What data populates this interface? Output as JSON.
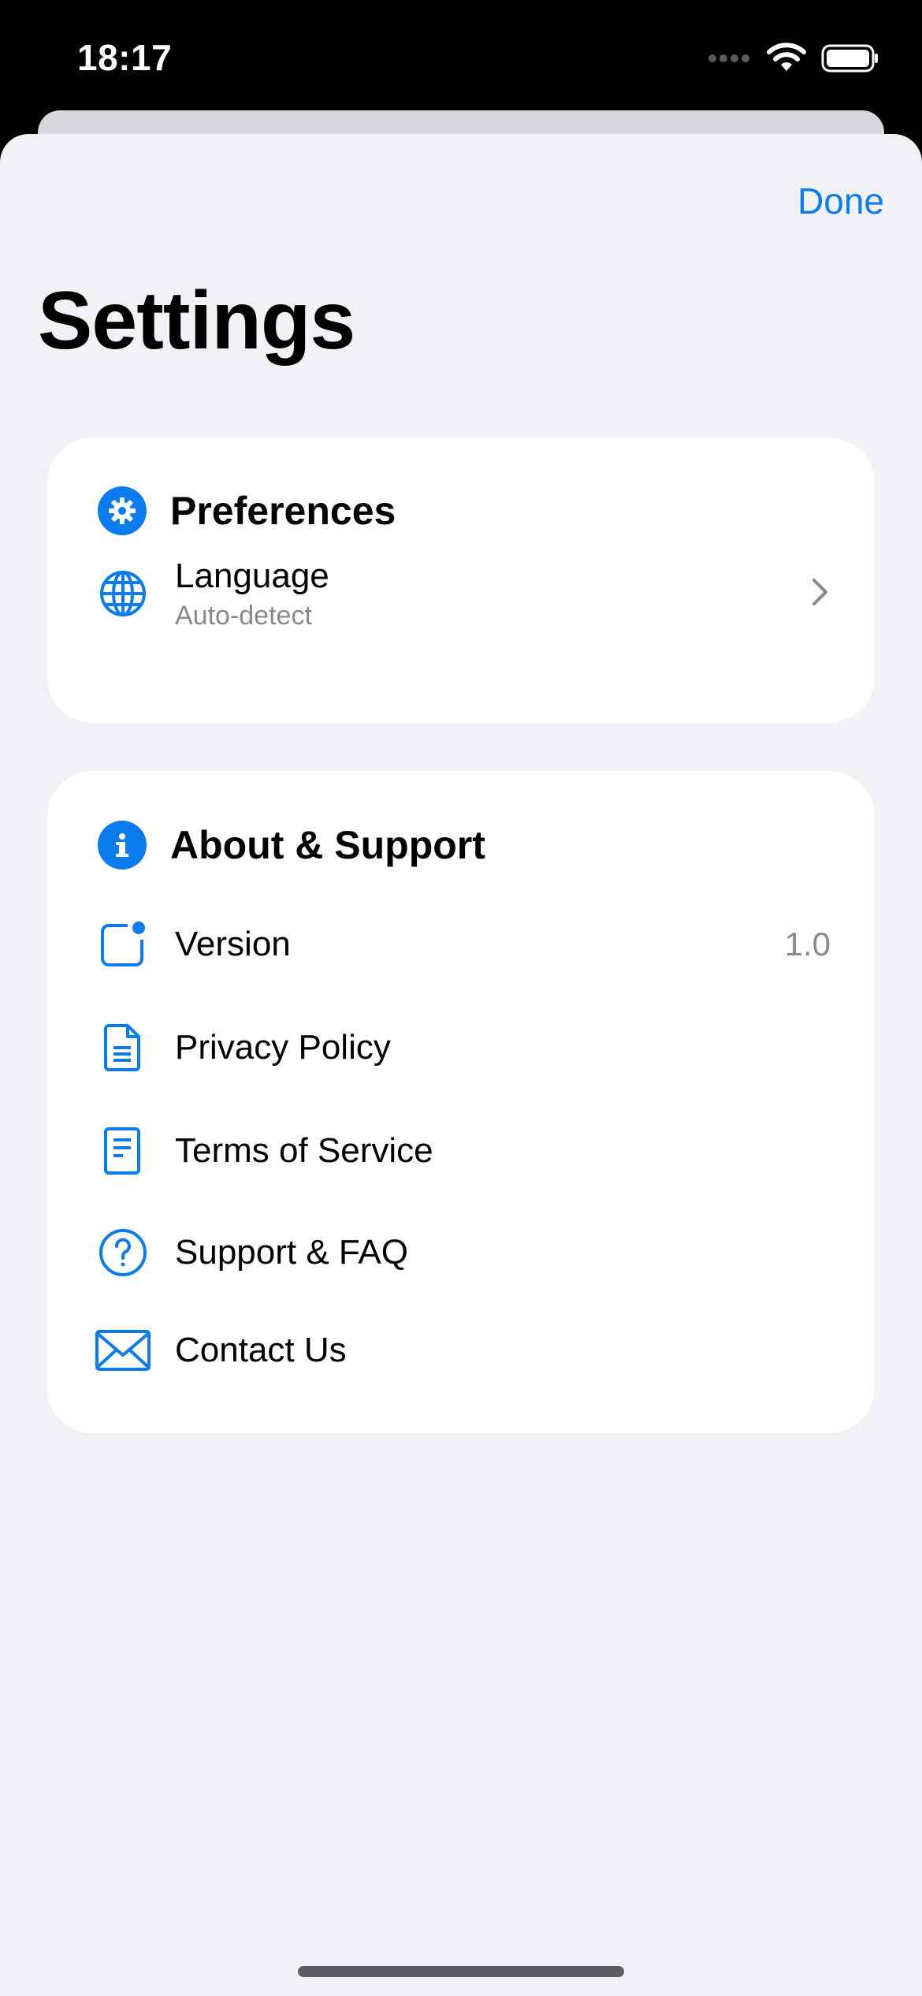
{
  "status_bar": {
    "time": "18:17",
    "signal_icon": "signal-dots-icon",
    "wifi_icon": "wifi-icon",
    "battery_icon": "battery-icon"
  },
  "header": {
    "done_label": "Done",
    "title": "Settings"
  },
  "preferences": {
    "title": "Preferences",
    "icon": "gear-icon",
    "items": [
      {
        "label": "Language",
        "subtitle": "Auto-detect",
        "icon": "globe-icon"
      }
    ]
  },
  "about": {
    "title": "About & Support",
    "icon": "info-icon",
    "items": [
      {
        "label": "Version",
        "value": "1.0",
        "icon": "app-badge-icon"
      },
      {
        "label": "Privacy Policy",
        "icon": "document-icon"
      },
      {
        "label": "Terms of Service",
        "icon": "doc-text-icon"
      },
      {
        "label": "Support & FAQ",
        "icon": "question-circle-icon"
      },
      {
        "label": "Contact Us",
        "icon": "envelope-icon"
      }
    ]
  },
  "colors": {
    "accent": "#0a7cf0",
    "background": "#f1f1f6",
    "card": "#ffffff",
    "secondary_text": "#8a8a8e"
  }
}
